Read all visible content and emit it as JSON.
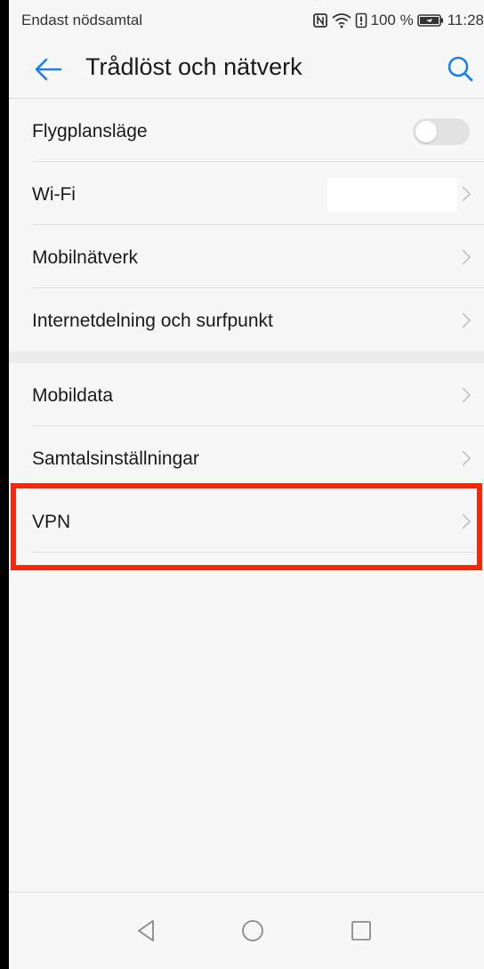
{
  "status_bar": {
    "carrier_text": "Endast nödsamtal",
    "battery_text": "100 %",
    "time": "11:28"
  },
  "header": {
    "title": "Trådlöst och nätverk",
    "back_icon": "arrow-left-icon",
    "search_icon": "search-icon",
    "accent_color": "#1a7fe8"
  },
  "settings": {
    "airplane_mode": {
      "label": "Flygplansläge",
      "enabled": false
    },
    "wifi": {
      "label": "Wi-Fi"
    },
    "mobile_network": {
      "label": "Mobilnätverk"
    },
    "tethering": {
      "label": "Internetdelning och surfpunkt"
    },
    "mobile_data": {
      "label": "Mobildata"
    },
    "call_settings": {
      "label": "Samtalsinställningar"
    },
    "vpn": {
      "label": "VPN",
      "highlight_color": "#f3290f"
    }
  },
  "nav_bar": {
    "back_icon": "triangle-back-icon",
    "home_icon": "circle-home-icon",
    "recent_icon": "square-recent-icon"
  }
}
